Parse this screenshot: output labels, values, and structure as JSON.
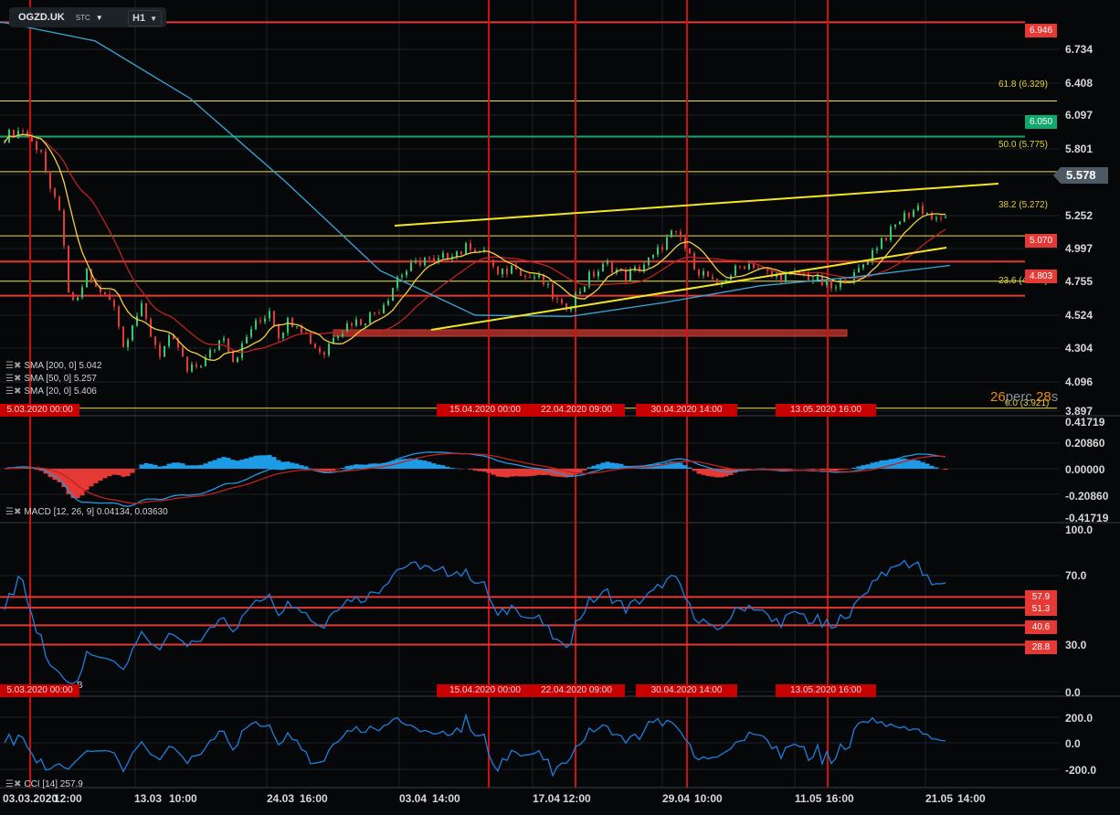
{
  "header": {
    "symbol": "OGZD.UK",
    "type": "STC",
    "timeframe": "H1"
  },
  "colors": {
    "bull": "#2ecc71",
    "bear": "#e53935",
    "sma20": "#f4d03f",
    "sma50": "#c0221f",
    "sma200": "#3aa6d8",
    "level_red": "#e53935",
    "level_green": "#13a86b",
    "fib": "#f1e040",
    "trend": "#f5e625"
  },
  "price_axis": [
    "6.734",
    "6.408",
    "6.097",
    "5.801",
    "5.252",
    "4.997",
    "4.755",
    "4.524",
    "4.304",
    "4.096",
    "3.897"
  ],
  "current_price": "5.578",
  "levels": [
    {
      "label": "6.946",
      "color": "red"
    },
    {
      "label": "6.050",
      "color": "green"
    },
    {
      "label": "5.070",
      "color": "red"
    },
    {
      "label": "4.803",
      "color": "red"
    }
  ],
  "fib": [
    "61.8 (6.329)",
    "50.0 (5.775)",
    "38.2 (5.272)",
    "23.6 (4.916)",
    "0.0 (3.921)"
  ],
  "timer": {
    "value1": "26",
    "unit1": "perc",
    "value2": "28",
    "unit2": "s"
  },
  "legends": {
    "sma200": "SMA [200, 0] 5.042",
    "sma50": "SMA [50, 0] 5.257",
    "sma20": "SMA [20, 0] 5.406",
    "macd": "MACD [12, 26, 9] 0.04134, 0.03630",
    "rsi": "B",
    "cci": "CCI [14] 257.9"
  },
  "date_tags": [
    "5.03.2020 00:00",
    "15.04.2020 00:00",
    "22.04.2020 09:00",
    "30.04.2020 14:00",
    "13.05.2020 16:00"
  ],
  "macd_axis": [
    "0.41719",
    "0.20860",
    "0.00000",
    "-0.20860",
    "-0.41719"
  ],
  "rsi_axis": [
    "100.0",
    "70.0",
    "30.0",
    "0.0"
  ],
  "rsi_levels": [
    "57.9",
    "51.3",
    "40.6",
    "28.8"
  ],
  "cci_axis": [
    "200.0",
    "0.0",
    "-200.0"
  ],
  "time_axis": [
    "03.03.2020",
    "12:00",
    "13.03",
    "10:00",
    "24.03",
    "16:00",
    "03.04",
    "14:00",
    "17.04",
    "12:00",
    "29.04",
    "10:00",
    "11.05",
    "16:00",
    "21.05",
    "14:00"
  ],
  "chart_data": {
    "type": "candlestick",
    "closes": [
      6.05,
      6.08,
      6.1,
      6.0,
      5.95,
      5.6,
      5.5,
      4.8,
      4.75,
      5.0,
      4.85,
      4.8,
      4.75,
      4.4,
      4.6,
      4.7,
      4.5,
      4.35,
      4.45,
      4.4,
      4.2,
      4.25,
      4.3,
      4.4,
      4.5,
      4.3,
      4.4,
      4.55,
      4.6,
      4.7,
      4.5,
      4.6,
      4.6,
      4.5,
      4.4,
      4.35,
      4.5,
      4.55,
      4.6,
      4.6,
      4.65,
      4.7,
      4.8,
      4.95,
      5.0,
      5.05,
      5.1,
      5.05,
      5.1,
      5.15,
      5.15,
      5.2,
      5.15,
      5.1,
      4.95,
      5.0,
      5.05,
      4.95,
      4.95,
      4.9,
      4.8,
      4.7,
      4.75,
      4.85,
      4.95,
      5.0,
      5.05,
      5.0,
      4.95,
      5.0,
      5.05,
      5.1,
      5.2,
      5.28,
      5.25,
      5.1,
      5.0,
      4.95,
      4.85,
      4.95,
      5.0,
      5.05,
      5.05,
      5.0,
      4.95,
      4.95,
      4.95,
      4.98,
      4.95,
      4.92,
      4.88,
      4.85,
      4.95,
      4.95,
      5.05,
      5.15,
      5.25,
      5.3,
      5.4,
      5.45,
      5.5,
      5.45,
      5.38,
      5.42
    ],
    "sma200": [
      6.95,
      6.8,
      6.35,
      5.7,
      5.0,
      4.65,
      4.64,
      4.75,
      4.88,
      4.95,
      5.04
    ]
  }
}
